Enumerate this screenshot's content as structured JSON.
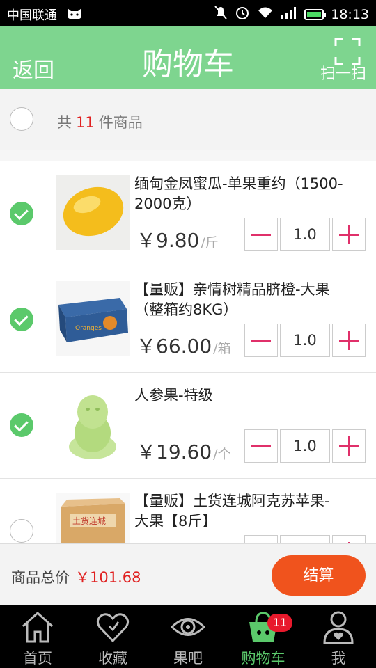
{
  "status_bar": {
    "carrier": "中国联通",
    "time": "18:13"
  },
  "header": {
    "back_label": "返回",
    "title": "购物车",
    "scan_label": "扫一扫"
  },
  "summary": {
    "prefix": "共",
    "count": "11",
    "suffix": "件商品"
  },
  "items": [
    {
      "name": "缅甸金凤蜜瓜-单果重约（1500-2000克）",
      "price": "￥9.80",
      "unit": "/斤",
      "quantity": "1.0",
      "checked": true,
      "image": "yellow-melon"
    },
    {
      "name": "【量贩】亲情树精品脐橙-大果（整箱约8KG）",
      "price": "￥66.00",
      "unit": "/箱",
      "quantity": "1.0",
      "checked": true,
      "image": "orange-box",
      "box_text": "Oranges"
    },
    {
      "name": "人参果-特级",
      "price": "￥19.60",
      "unit": "/个",
      "quantity": "1.0",
      "checked": true,
      "image": "ginseng-fruit"
    },
    {
      "name": "【量贩】土货连城阿克苏苹果-大果【8斤】",
      "price": "",
      "unit": "",
      "quantity": "",
      "checked": false,
      "image": "apple-box",
      "box_text": "土货连城"
    }
  ],
  "total": {
    "label": "商品总价",
    "value": "￥101.68"
  },
  "checkout_label": "结算",
  "tabs": [
    {
      "label": "首页",
      "icon": "home-icon"
    },
    {
      "label": "收藏",
      "icon": "heart-icon"
    },
    {
      "label": "果吧",
      "icon": "eye-icon"
    },
    {
      "label": "购物车",
      "icon": "cart-icon",
      "badge": "11",
      "active": true
    },
    {
      "label": "我",
      "icon": "user-icon"
    }
  ],
  "colors": {
    "header": "#7ed58f",
    "accent_green": "#5bc96b",
    "price_red": "#e02020",
    "checkout": "#f0531d",
    "stepper": "#e0306a"
  }
}
